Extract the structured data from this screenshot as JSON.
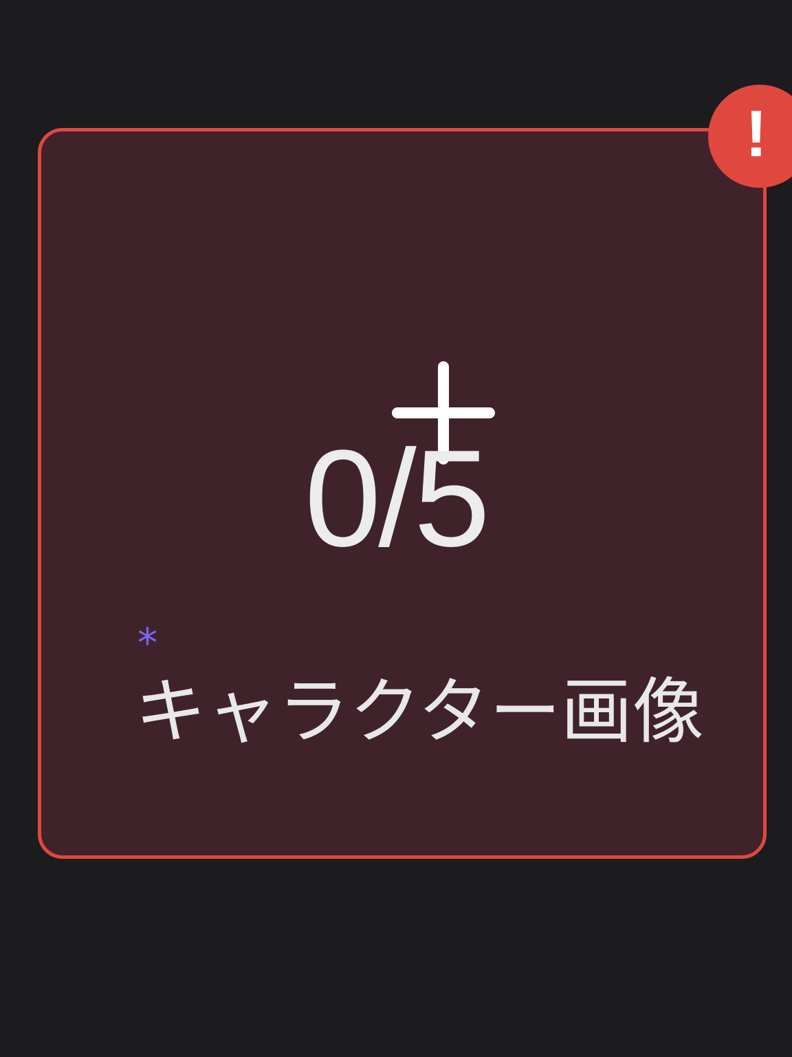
{
  "upload_card": {
    "icon": "plus-icon",
    "count": "0/5",
    "required_marker": "*",
    "label": "キャラクター画像"
  },
  "error_badge": {
    "icon": "exclamation-icon",
    "glyph": "!"
  },
  "colors": {
    "background": "#1c1c1e",
    "card_fill": "#40232a",
    "error_border": "#e0483f",
    "required_marker": "#7b66ff",
    "text": "#ececec"
  }
}
